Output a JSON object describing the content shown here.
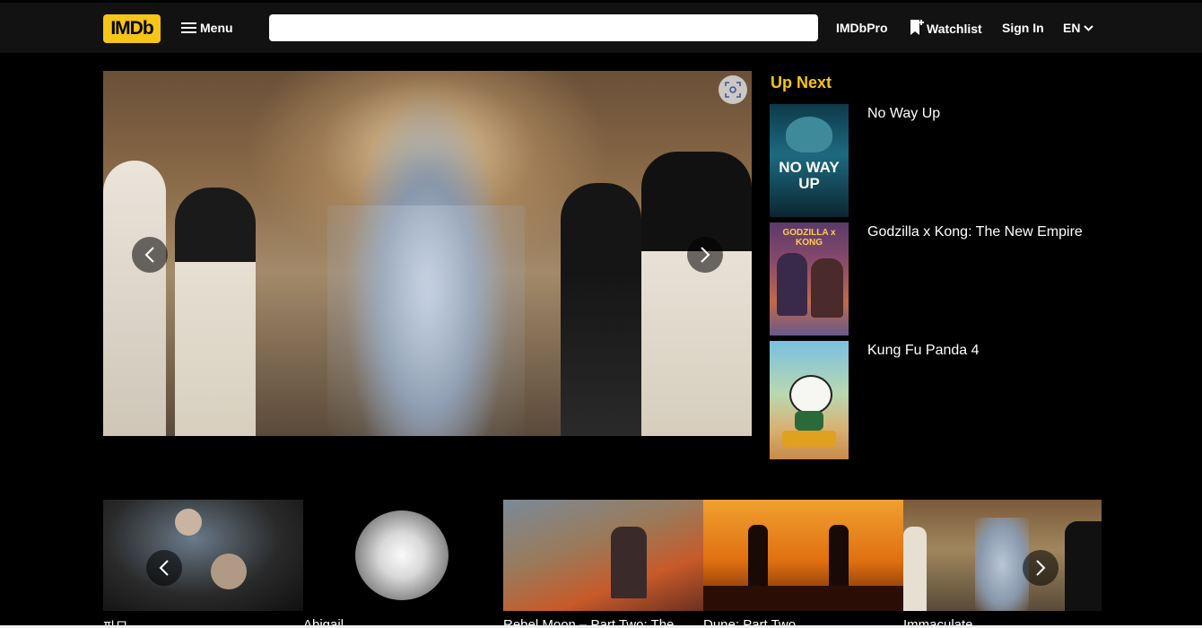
{
  "header": {
    "logo": "IMDb",
    "menu_label": "Menu",
    "search_placeholder": "",
    "imdbpro_label": "IMDbPro",
    "watchlist_label": "Watchlist",
    "signin_label": "Sign In",
    "language_label": "EN"
  },
  "up_next": {
    "heading": "Up Next",
    "items": [
      {
        "title": "No Way Up",
        "poster_text": "NO WAY UP"
      },
      {
        "title": "Godzilla x Kong: The New Empire",
        "poster_text": "GODZILLA x KONG"
      },
      {
        "title": "Kung Fu Panda 4",
        "poster_text": ""
      }
    ]
  },
  "strip": {
    "captions": [
      "파묘",
      "Abigail",
      "Rebel Moon – Part Two: The",
      "Dune: Part Two",
      "Immaculate"
    ]
  },
  "colors": {
    "brand_yellow": "#f5c518",
    "header_bg": "#121212",
    "page_bg": "#000000"
  }
}
